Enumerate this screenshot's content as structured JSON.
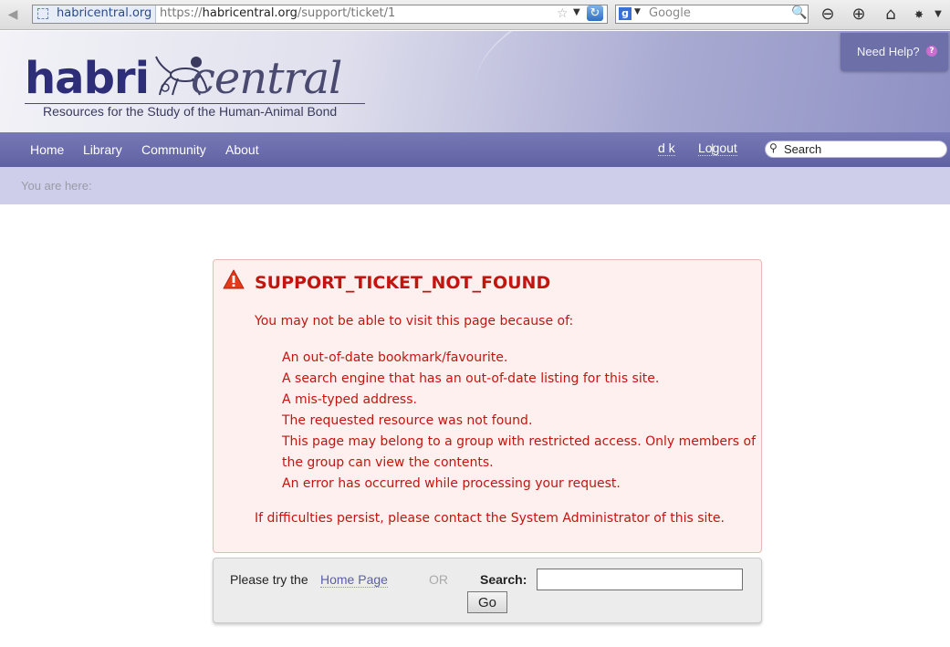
{
  "browser": {
    "site_identity": "habricentral.org",
    "url_prefix": "https://",
    "url_domain": "habricentral.org",
    "url_path": "/support/ticket/1",
    "search_engine_placeholder": "Google"
  },
  "header": {
    "logo_left": "habri",
    "logo_right": "central",
    "tagline": "Resources for the Study of the Human-Animal Bond",
    "need_help": "Need Help?"
  },
  "nav": {
    "items": [
      "Home",
      "Library",
      "Community",
      "About"
    ],
    "user": "d k",
    "separator": "|",
    "logout": "Logout",
    "search_placeholder": "Search"
  },
  "breadcrumb": {
    "label": "You are here:"
  },
  "error": {
    "title": "SUPPORT_TICKET_NOT_FOUND",
    "intro": "You may not be able to visit this page because of:",
    "reasons": [
      "An out-of-date bookmark/favourite.",
      "A search engine that has an out-of-date listing for this site.",
      "A mis-typed address.",
      "The requested resource was not found.",
      "This page may belong to a group with restricted access. Only members of the group can view the contents.",
      "An error has occurred while processing your request."
    ],
    "footer": "If difficulties persist, please contact the System Administrator of this site."
  },
  "recovery": {
    "try_text": "Please try the",
    "home_link": "Home Page",
    "or_text": "OR",
    "search_label": "Search:",
    "search_value": "",
    "go_label": "Go"
  },
  "colors": {
    "nav_bg": "#6b6dac",
    "breadcrumb_bg": "#ceceea",
    "error_text": "#c3150f",
    "error_bg": "#fdf0ee"
  }
}
